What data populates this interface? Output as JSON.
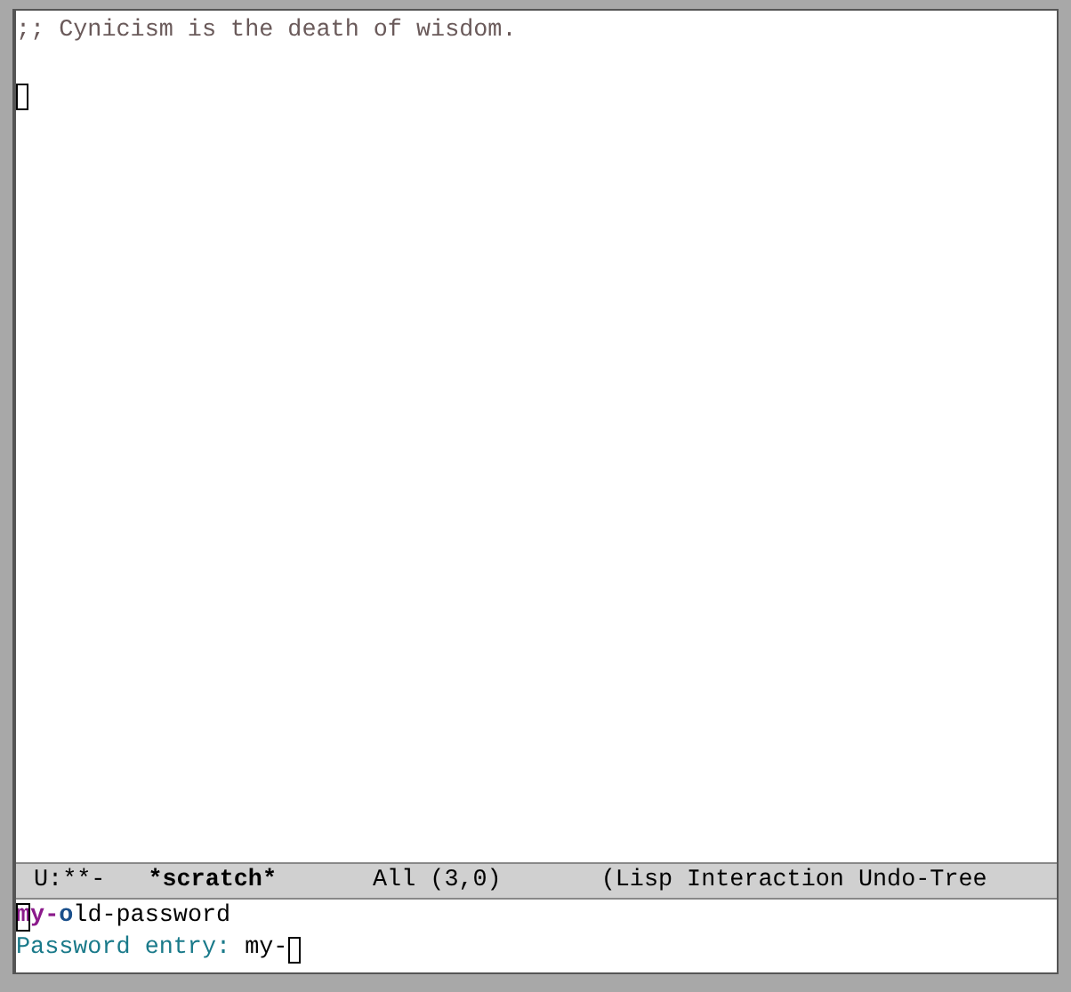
{
  "buffer": {
    "lines": [
      ";; Cynicism is the death of wisdom."
    ]
  },
  "mode_line": {
    "status": "U:**-",
    "buffer_name": "*scratch*",
    "position": "All (3,0)",
    "modes": "(Lisp Interaction Undo-Tree"
  },
  "completion": [
    {
      "text": "my-",
      "kind": "match"
    },
    {
      "text": "o",
      "kind": "next"
    },
    {
      "text": "ld-password",
      "kind": "rest"
    }
  ],
  "minibuffer": {
    "prompt": "Password entry:",
    "value": "my-"
  }
}
